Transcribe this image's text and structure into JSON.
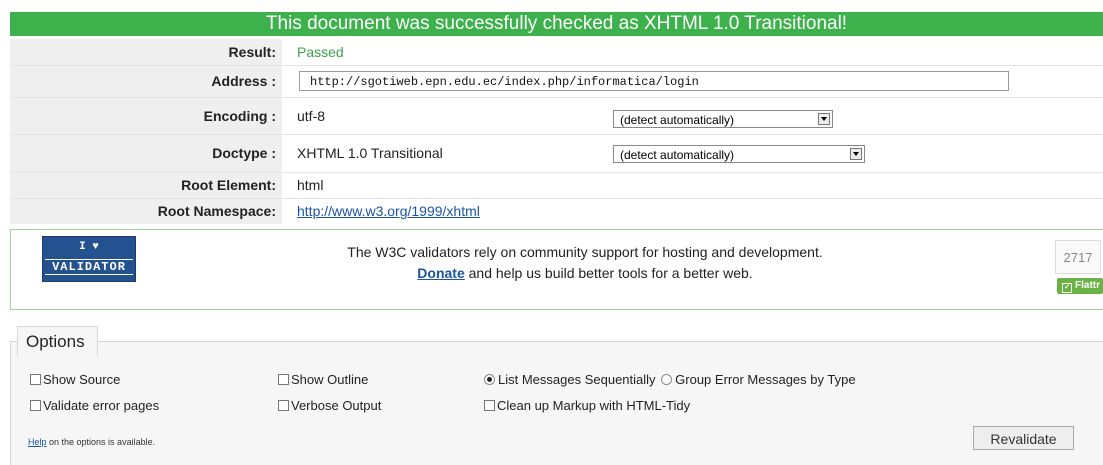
{
  "banner": {
    "text": "This document was successfully checked as XHTML 1.0 Transitional!"
  },
  "results": {
    "result_label": "Result:",
    "result_value": "Passed",
    "address_label": "Address :",
    "address_value": "http://sgotiweb.epn.edu.ec/index.php/informatica/login",
    "encoding_label": "Encoding :",
    "encoding_value": "utf-8",
    "encoding_select": "(detect automatically)",
    "doctype_label": "Doctype :",
    "doctype_value": "XHTML 1.0 Transitional",
    "doctype_select": "(detect automatically)",
    "root_element_label": "Root Element:",
    "root_element_value": "html",
    "root_namespace_label": "Root Namespace:",
    "root_namespace_value": "http://www.w3.org/1999/xhtml"
  },
  "support": {
    "badge_line1": "I ♥",
    "badge_line2": "VALIDATOR",
    "message_line1": "The W3C validators rely on community support for hosting and development.",
    "donate_link": "Donate",
    "message_line2_rest": " and help us build better tools for a better web.",
    "flattr_count": "2717",
    "flattr_label": "Flattr"
  },
  "options": {
    "legend": "Options",
    "show_source": "Show Source",
    "show_outline": "Show Outline",
    "list_sequentially": "List Messages Sequentially",
    "group_by_type": "Group Error Messages by Type",
    "validate_error_pages": "Validate error pages",
    "verbose_output": "Verbose Output",
    "cleanup_markup": "Clean up Markup with HTML-Tidy",
    "help_link": "Help",
    "help_rest": " on the options is available.",
    "revalidate_button": "Revalidate"
  },
  "colors": {
    "banner_green": "#3db14c",
    "passed_green": "#3da34a",
    "link_blue": "#1a54a6"
  }
}
